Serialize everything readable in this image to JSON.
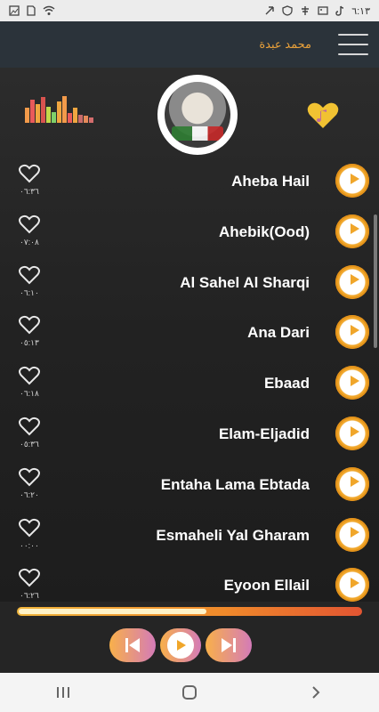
{
  "status": {
    "time": "٦:١٣",
    "left_icons": [
      "image-icon",
      "sim-icon",
      "wifi-icon"
    ],
    "right_icons": [
      "share-icon",
      "vpn-icon",
      "tree-icon",
      "photo-icon",
      "tiktok-icon"
    ]
  },
  "app_bar": {
    "title": "محمد عبدة",
    "menu_icon": "menu-icon"
  },
  "header": {
    "equalizer_colors": [
      "#f29a4a",
      "#e95a5a",
      "#f0a640",
      "#d9534f",
      "#c4d94a",
      "#7ed06a",
      "#f0a640",
      "#f29a4a",
      "#e95a5a",
      "#f0a640",
      "#c96b6b",
      "#e48a5a",
      "#d46d6d"
    ],
    "equalizer_levels": [
      0.55,
      0.85,
      0.7,
      0.95,
      0.6,
      0.4,
      0.8,
      1.0,
      0.35,
      0.55,
      0.3,
      0.25,
      0.2
    ],
    "avatar": "singer-photo",
    "favorite_icon": "heart-music-icon",
    "favorite_color": "#f1c232"
  },
  "tracks": [
    {
      "title": "Aheba Hail",
      "duration": "٠٦:٣٦"
    },
    {
      "title": "Ahebik(Ood)",
      "duration": "٠٧:٠٨"
    },
    {
      "title": "Al Sahel Al Sharqi",
      "duration": "٠٦:١٠"
    },
    {
      "title": "Ana Dari",
      "duration": "٠٥:١٣"
    },
    {
      "title": "Ebaad",
      "duration": "٠٦:١٨"
    },
    {
      "title": "Elam-Eljadid",
      "duration": "٠٥:٣٦"
    },
    {
      "title": "Entaha Lama Ebtada",
      "duration": "٠٦:٢٠"
    },
    {
      "title": "Esmaheli Yal Gharam",
      "duration": "٠٠:٠٠"
    },
    {
      "title": "Eyoon Ellail",
      "duration": "٠٦:٢٦"
    }
  ],
  "player": {
    "progress_fraction": 0.55,
    "prev_icon": "skip-previous-icon",
    "play_icon": "play-icon",
    "next_icon": "skip-next-icon",
    "accent": "#f0a62a"
  },
  "nav": {
    "recents_icon": "recents-icon",
    "home_icon": "home-icon",
    "back_icon": "back-icon"
  }
}
